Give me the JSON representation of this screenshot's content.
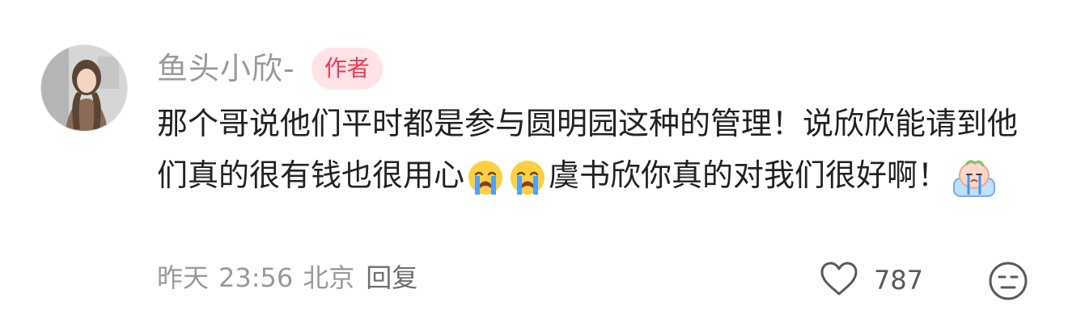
{
  "comment": {
    "username": "鱼头小欣-",
    "author_badge": "作者",
    "text_part_1": "那个哥说他们平时都是参与圆明园这种的管理！说欣欣能请到他们真的很有钱也很用心",
    "text_part_2": "虞书欣你真的对我们很好啊！",
    "emojis": [
      "crying-emoji",
      "crying-emoji",
      "sad-baby-sticker"
    ],
    "timestamp": {
      "date": "昨天",
      "time": "23:56",
      "location": "北京"
    },
    "reply_label": "回复",
    "like_count": "787",
    "colors": {
      "username": "#9a9a9a",
      "badge_text": "#f03a53",
      "badge_bg": "#ffe3e6",
      "content": "#222222",
      "meta": "#9a9a9a"
    }
  }
}
